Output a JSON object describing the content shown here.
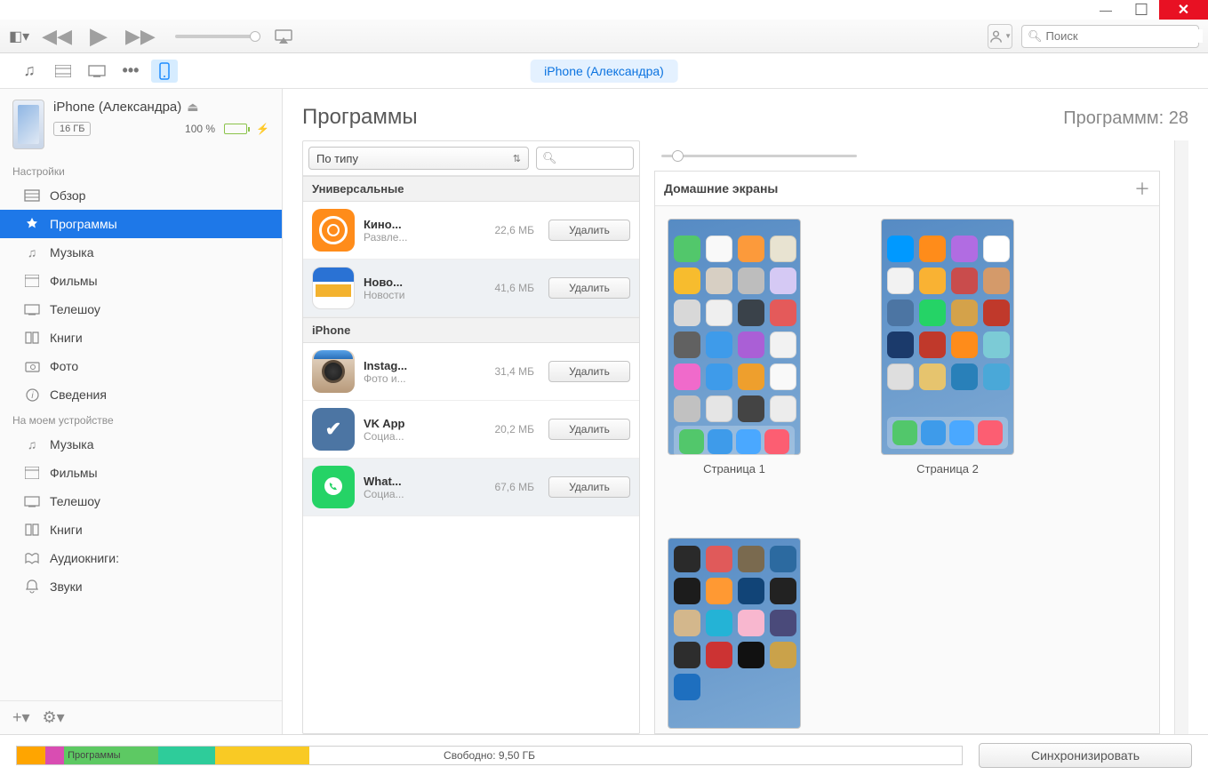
{
  "window": {
    "minimize": "—",
    "maximize": "☐",
    "close": "✕"
  },
  "toolbar": {
    "search_placeholder": "Поиск"
  },
  "device_pill": "iPhone (Александра)",
  "device": {
    "name": "iPhone (Александра)",
    "capacity": "16 ГБ",
    "battery_pct": "100 %"
  },
  "sidebar": {
    "settings_label": "Настройки",
    "settings": [
      {
        "icon": "overview",
        "label": "Обзор"
      },
      {
        "icon": "apps",
        "label": "Программы",
        "active": true
      },
      {
        "icon": "music",
        "label": "Музыка"
      },
      {
        "icon": "movies",
        "label": "Фильмы"
      },
      {
        "icon": "tv",
        "label": "Телешоу"
      },
      {
        "icon": "books",
        "label": "Книги"
      },
      {
        "icon": "photos",
        "label": "Фото"
      },
      {
        "icon": "info",
        "label": "Сведения"
      }
    ],
    "ondevice_label": "На моем устройстве",
    "ondevice": [
      {
        "icon": "music",
        "label": "Музыка"
      },
      {
        "icon": "movies",
        "label": "Фильмы"
      },
      {
        "icon": "tv",
        "label": "Телешоу"
      },
      {
        "icon": "books",
        "label": "Книги"
      },
      {
        "icon": "audiobooks",
        "label": "Аудиокниги:"
      },
      {
        "icon": "tones",
        "label": "Звуки"
      }
    ]
  },
  "content": {
    "title": "Программы",
    "count_label": "Программм: 28",
    "sort_label": "По типу",
    "groups": [
      {
        "title": "Универсальные",
        "apps": [
          {
            "name": "Кино...",
            "cat": "Развле...",
            "size": "22,6 МБ",
            "btn": "Удалить",
            "color": "#ff8c1a"
          },
          {
            "name": "Ново...",
            "cat": "Новости",
            "size": "41,6 МБ",
            "btn": "Удалить",
            "color": "#ffffff",
            "selected": true
          }
        ]
      },
      {
        "title": "iPhone",
        "apps": [
          {
            "name": "Instag...",
            "cat": "Фото и...",
            "size": "31,4 МБ",
            "btn": "Удалить",
            "color": "#c9b29b"
          },
          {
            "name": "VK App",
            "cat": "Социа...",
            "size": "20,2 МБ",
            "btn": "Удалить",
            "color": "#4c75a3"
          },
          {
            "name": "What...",
            "cat": "Социа...",
            "size": "67,6 МБ",
            "btn": "Удалить",
            "color": "#25d366",
            "selected": true
          }
        ]
      }
    ],
    "hs_title": "Домашние экраны",
    "pages": [
      {
        "label": "Страница 1",
        "dock": true,
        "rows": 6,
        "colors": [
          "#52c76b",
          "#f9f9f9",
          "#fc9a3b",
          "#e8e3d1",
          "#f7bc2e",
          "#d7cfc3",
          "#bdbdbd",
          "#d5c9f4",
          "#d8d8d8",
          "#efefef",
          "#3a424a",
          "#e45a5a",
          "#616161",
          "#3e9bea",
          "#aa5fd6",
          "#f2f2f2",
          "#f06acb",
          "#3e9bea",
          "#ee9f2d",
          "#f9f9f9",
          "#c1c1c1",
          "#e5e5e5",
          "#444444",
          "#ececec"
        ]
      },
      {
        "label": "Страница 2",
        "dock": true,
        "rows": 5,
        "colors": [
          "#0099ff",
          "#ff8c1a",
          "#b16ce2",
          "#ffffff",
          "#f2f2f2",
          "#f9b233",
          "#c94c4c",
          "#d49a6a",
          "#4c75a3",
          "#25d366",
          "#d4a24a",
          "#c0392b",
          "#1b3a6b",
          "#c0392b",
          "#ff8c1a",
          "#7ccbd6",
          "#dedede",
          "#e6c46e",
          "#2980b9",
          "#4aa8d8"
        ]
      },
      {
        "label": "",
        "dock": false,
        "rows": 4,
        "page3": true,
        "colors": [
          "#2a2a2a",
          "#e05a5a",
          "#7a6a4f",
          "#2c6aa0",
          "#1c1c1c",
          "#ff9933",
          "#114477",
          "#222222",
          "#d3b78c",
          "#24b3d6",
          "#f8b7cf",
          "#4a4a7a",
          "#2d2d2d",
          "#cc3333",
          "#111111",
          "#caa24a",
          "#1e6fbf",
          "",
          ""
        ]
      }
    ]
  },
  "footer": {
    "seg_label": "Программы",
    "free_text": "Свободно: 9,50 ГБ",
    "sync": "Синхронизировать",
    "segments": [
      {
        "color": "#ffa500",
        "w": 3
      },
      {
        "color": "#d94db2",
        "w": 2
      },
      {
        "color": "#5dc963",
        "w": 10,
        "label": true
      },
      {
        "color": "#2ecc9a",
        "w": 6
      },
      {
        "color": "#f9ca24",
        "w": 10
      },
      {
        "color": "#ffffff",
        "w": 69
      }
    ]
  }
}
